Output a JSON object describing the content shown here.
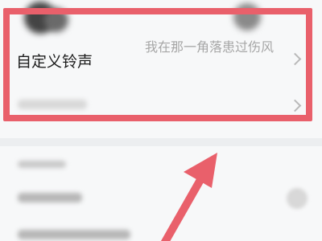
{
  "custom_ringtone": {
    "label": "自定义铃声",
    "value": "我在那一角落患过伤风"
  }
}
